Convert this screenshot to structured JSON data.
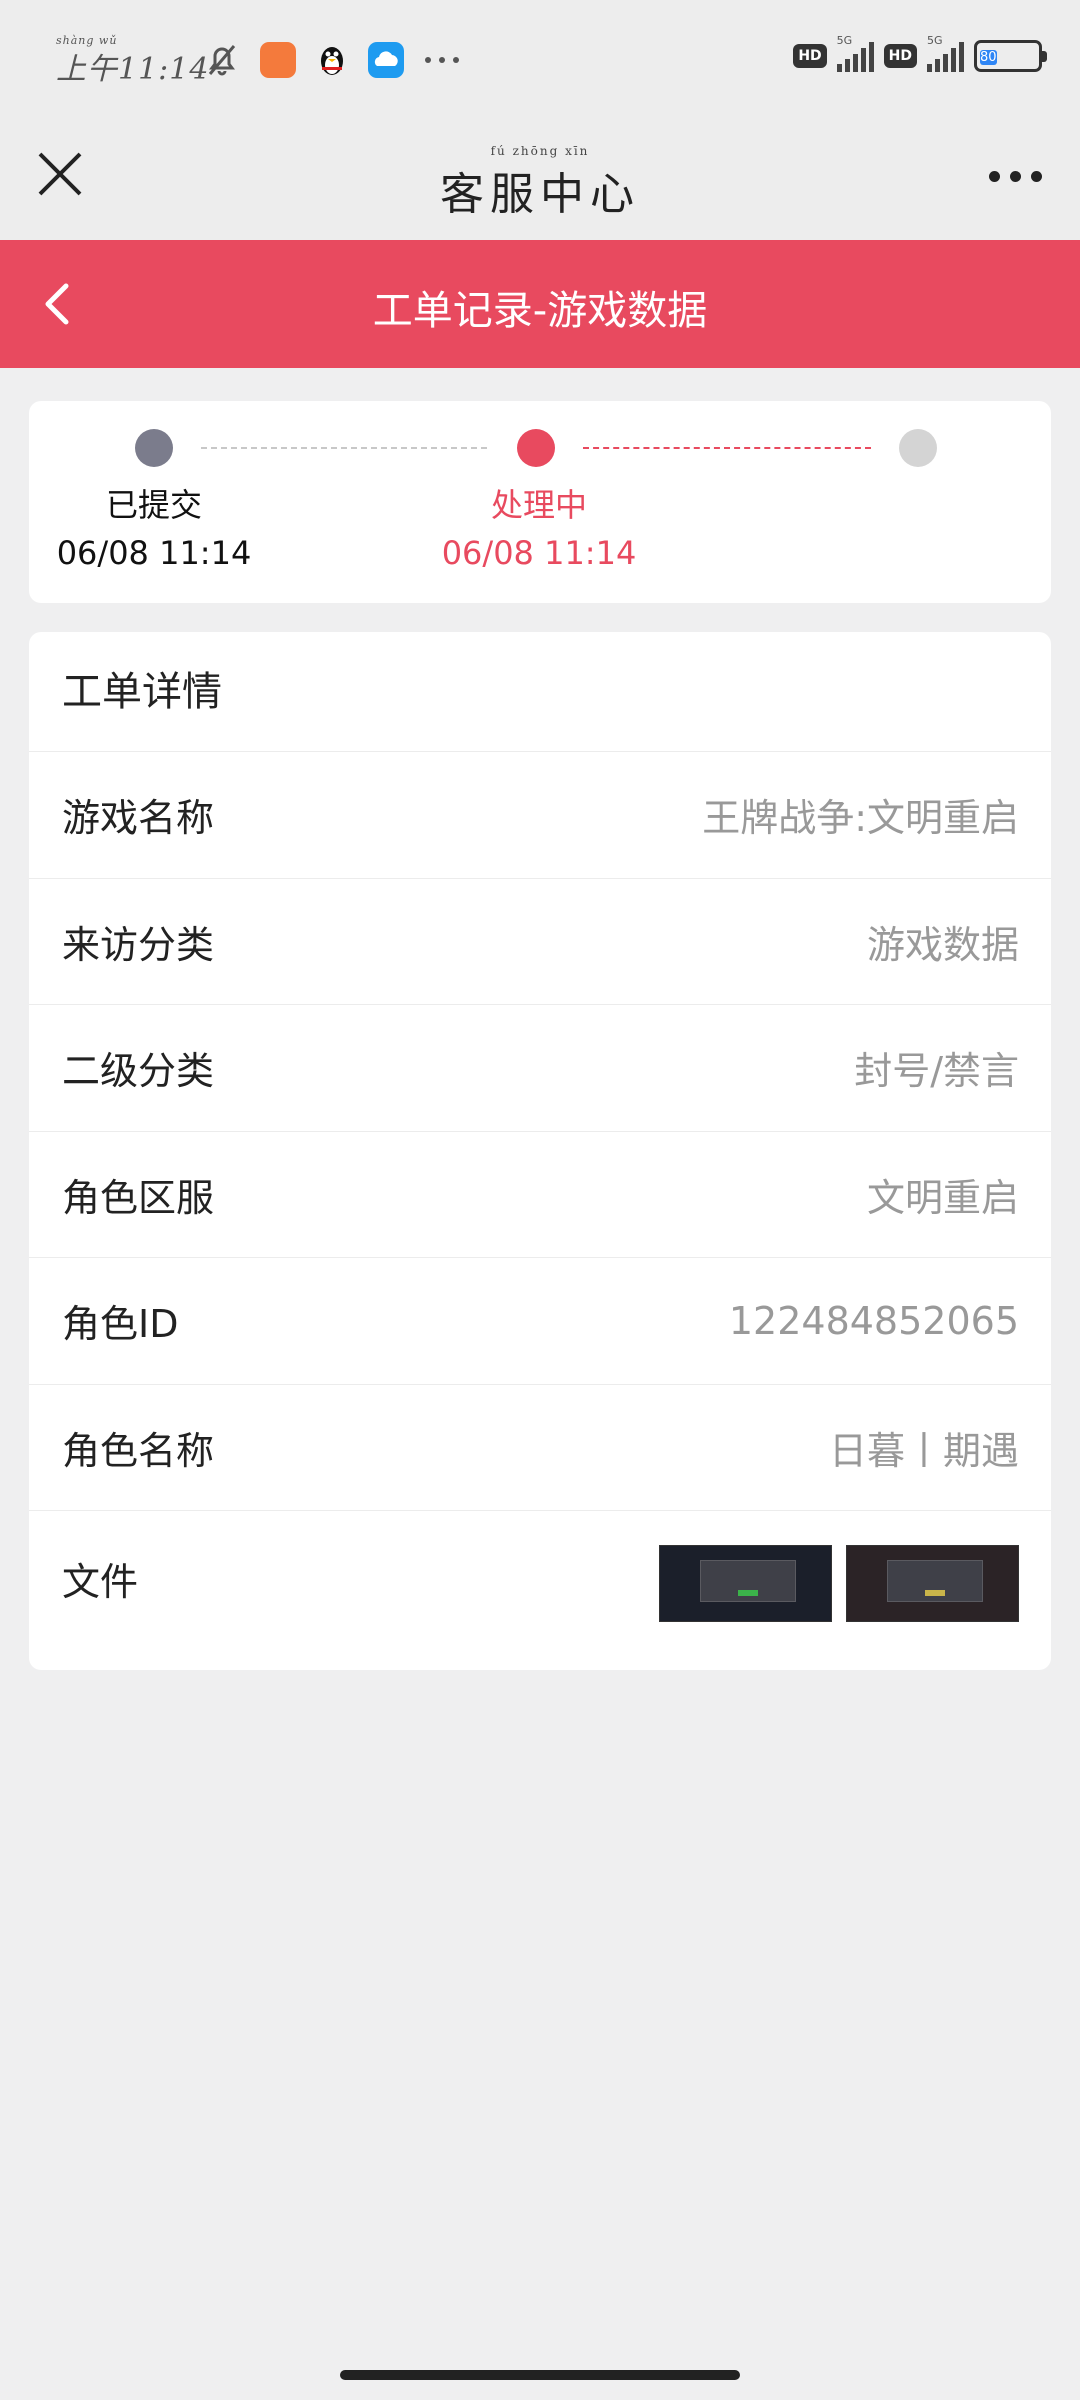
{
  "status_bar": {
    "time": "上午11:14",
    "time_ruby": "shàng wǔ",
    "net_label_1": "5G",
    "net_label_2": "5G",
    "hd_1": "HD",
    "hd_2": "HD",
    "battery": "80",
    "battery_level": 0.8
  },
  "title_bar": {
    "title": "客服中心",
    "title_ruby": "fú zhōng xīn"
  },
  "header": {
    "title": "工单记录-游戏数据"
  },
  "progress": {
    "steps": [
      {
        "label": "已提交",
        "time": "06/08 11:14",
        "state": "done"
      },
      {
        "label": "处理中",
        "time": "06/08 11:14",
        "state": "current"
      },
      {
        "label": "",
        "time": "",
        "state": "pending"
      }
    ]
  },
  "detail": {
    "heading": "工单详情",
    "rows": [
      {
        "key": "游戏名称",
        "value": "王牌战争:文明重启"
      },
      {
        "key": "来访分类",
        "value": "游戏数据"
      },
      {
        "key": "二级分类",
        "value": "封号/禁言"
      },
      {
        "key": "角色区服",
        "value": "文明重启"
      },
      {
        "key": "角色ID",
        "value": "122484852065"
      },
      {
        "key": "角色名称",
        "value": "日暮丨期遇"
      }
    ],
    "files_label": "文件"
  },
  "colors": {
    "accent": "#e84a5f",
    "background": "#efeff0"
  }
}
